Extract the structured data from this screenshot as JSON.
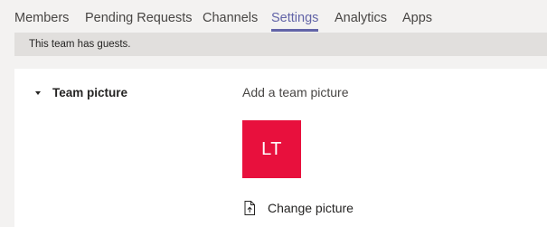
{
  "tabs": [
    {
      "label": "Members",
      "active": false
    },
    {
      "label": "Pending Requests",
      "active": false
    },
    {
      "label": "Channels",
      "active": false
    },
    {
      "label": "Settings",
      "active": true
    },
    {
      "label": "Analytics",
      "active": false
    },
    {
      "label": "Apps",
      "active": false
    }
  ],
  "banner": {
    "text": "This team has guests."
  },
  "team_picture": {
    "section_title": "Team picture",
    "expanded": true,
    "toggle_icon": "chevron-down-icon",
    "add_label": "Add a team picture",
    "avatar_initials": "LT",
    "avatar_color": "#e8103d",
    "change_label": "Change picture",
    "change_icon": "upload-file-icon"
  },
  "colors": {
    "accent": "#6264a7",
    "page_background": "#f3f2f1",
    "banner_background": "#e1dfdd",
    "panel_background": "#ffffff"
  }
}
